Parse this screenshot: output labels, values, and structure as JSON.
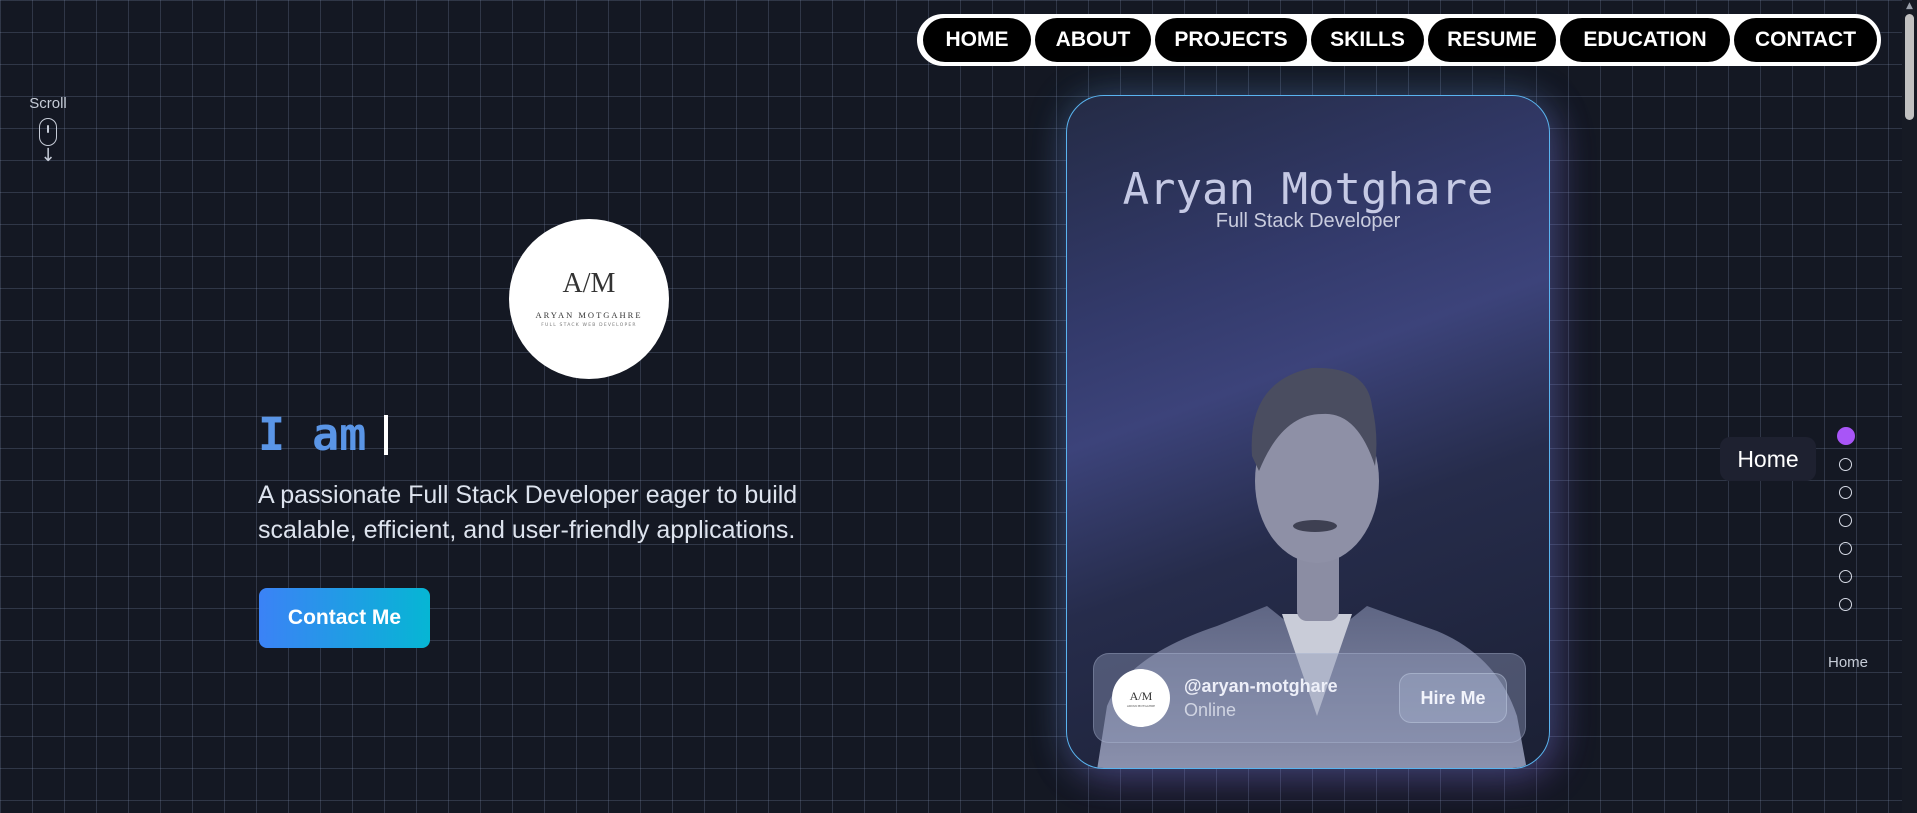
{
  "nav": {
    "items": [
      {
        "label": "HOME",
        "width": 108
      },
      {
        "label": "ABOUT",
        "width": 116
      },
      {
        "label": "PROJECTS",
        "width": 152
      },
      {
        "label": "SKILLS",
        "width": 113
      },
      {
        "label": "RESUME",
        "width": 128
      },
      {
        "label": "EDUCATION",
        "width": 170
      },
      {
        "label": "CONTACT",
        "width": 143
      }
    ]
  },
  "scroll_indicator": {
    "label": "Scroll"
  },
  "logo": {
    "monogram": "A/M",
    "name": "ARYAN MOTGAHRE",
    "subtitle": "FULL STACK WEB DEVELOPER"
  },
  "hero": {
    "typed_text": "I am",
    "tagline_line1": "A passionate Full Stack Developer eager to build",
    "tagline_line2": "scalable, efficient, and user-friendly applications.",
    "cta_label": "Contact Me"
  },
  "card": {
    "name": "Aryan Motghare",
    "role": "Full Stack Developer",
    "handle": "@aryan-motghare",
    "status": "Online",
    "hire_label": "Hire Me"
  },
  "section_nav": {
    "tooltip": "Home",
    "active_index": 0,
    "dot_count": 7,
    "current_label": "Home",
    "active_color": "#a855f7"
  }
}
